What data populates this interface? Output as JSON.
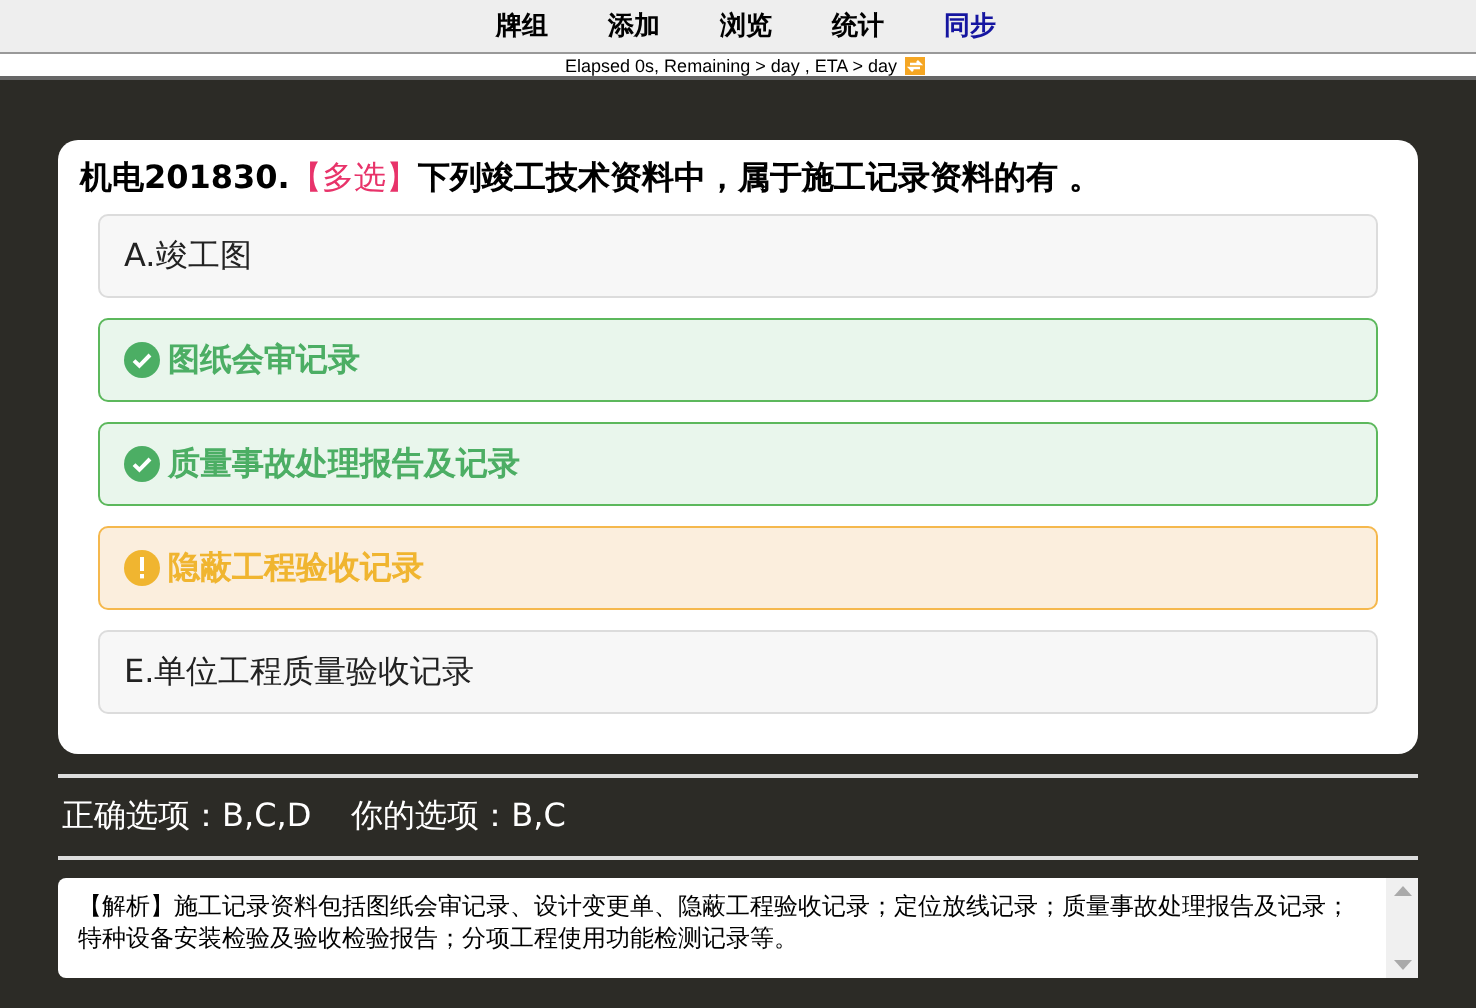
{
  "nav": [
    {
      "label": "牌组",
      "selected": false
    },
    {
      "label": "添加",
      "selected": false
    },
    {
      "label": "浏览",
      "selected": false
    },
    {
      "label": "统计",
      "selected": false
    },
    {
      "label": "同步",
      "selected": true
    }
  ],
  "status": "Elapsed 0s, Remaining > day , ETA > day",
  "question": {
    "number": "机电201830.",
    "tag": "【多选】",
    "text": "下列竣工技术资料中，属于施工记录资料的有 。"
  },
  "options": [
    {
      "letter": "A.",
      "text": "竣工图",
      "kind": "normal"
    },
    {
      "text": "图纸会审记录",
      "kind": "correct"
    },
    {
      "text": "质量事故处理报告及记录",
      "kind": "correct"
    },
    {
      "text": "隐蔽工程验收记录",
      "kind": "missed"
    },
    {
      "letter": "E.",
      "text": "单位工程质量验收记录",
      "kind": "normal"
    }
  ],
  "answers": {
    "correct": "正确选项：B,C,D",
    "yours": "你的选项：B,C"
  },
  "analysis": "【解析】施工记录资料包括图纸会审记录、设计变更单、隐蔽工程验收记录；定位放线记录；质量事故处理报告及记录；特种设备安装检验及验收检验报告；分项工程使用功能检测记录等。"
}
